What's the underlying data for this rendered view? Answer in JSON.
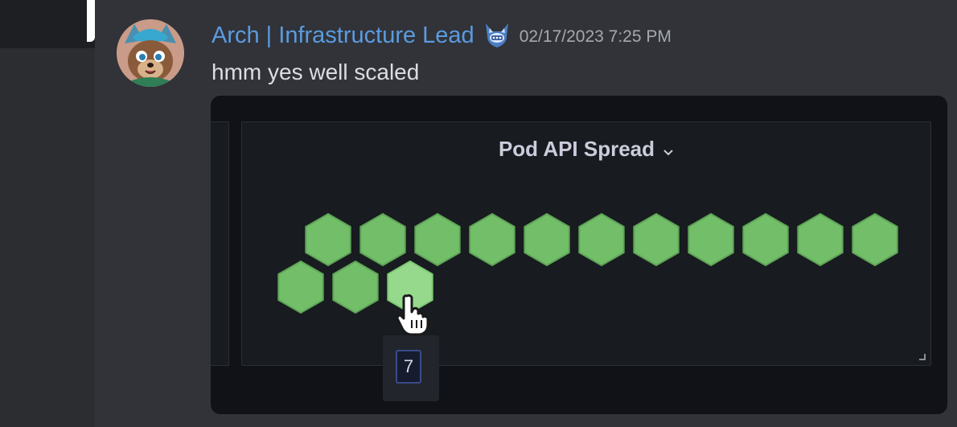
{
  "message": {
    "author": "Arch | Infrastructure Lead",
    "timestamp": "02/17/2023 7:25 PM",
    "text": "hmm yes well scaled",
    "avatar_icon": "fox-avatar-icon",
    "badge_icon": "fox-badge-icon"
  },
  "embed": {
    "panel_title": "Pod API Spread",
    "hexagons": [
      {
        "row": 1,
        "col": 0,
        "highlighted": false
      },
      {
        "row": 1,
        "col": 1,
        "highlighted": false
      },
      {
        "row": 1,
        "col": 2,
        "highlighted": true
      },
      {
        "row": 0,
        "col": 0,
        "highlighted": false
      },
      {
        "row": 0,
        "col": 1,
        "highlighted": false
      },
      {
        "row": 0,
        "col": 2,
        "highlighted": false
      },
      {
        "row": 0,
        "col": 3,
        "highlighted": false
      },
      {
        "row": 0,
        "col": 4,
        "highlighted": false
      },
      {
        "row": 0,
        "col": 5,
        "highlighted": false
      },
      {
        "row": 0,
        "col": 6,
        "highlighted": false
      },
      {
        "row": 0,
        "col": 7,
        "highlighted": false
      },
      {
        "row": 0,
        "col": 8,
        "highlighted": false
      },
      {
        "row": 0,
        "col": 9,
        "highlighted": false
      },
      {
        "row": 0,
        "col": 10,
        "highlighted": false
      }
    ],
    "tooltip_value": "7"
  },
  "colors": {
    "author_name": "#5a9be0",
    "hex_fill": "#73bf69",
    "hex_highlight": "#96d98d",
    "background": "#313338"
  }
}
